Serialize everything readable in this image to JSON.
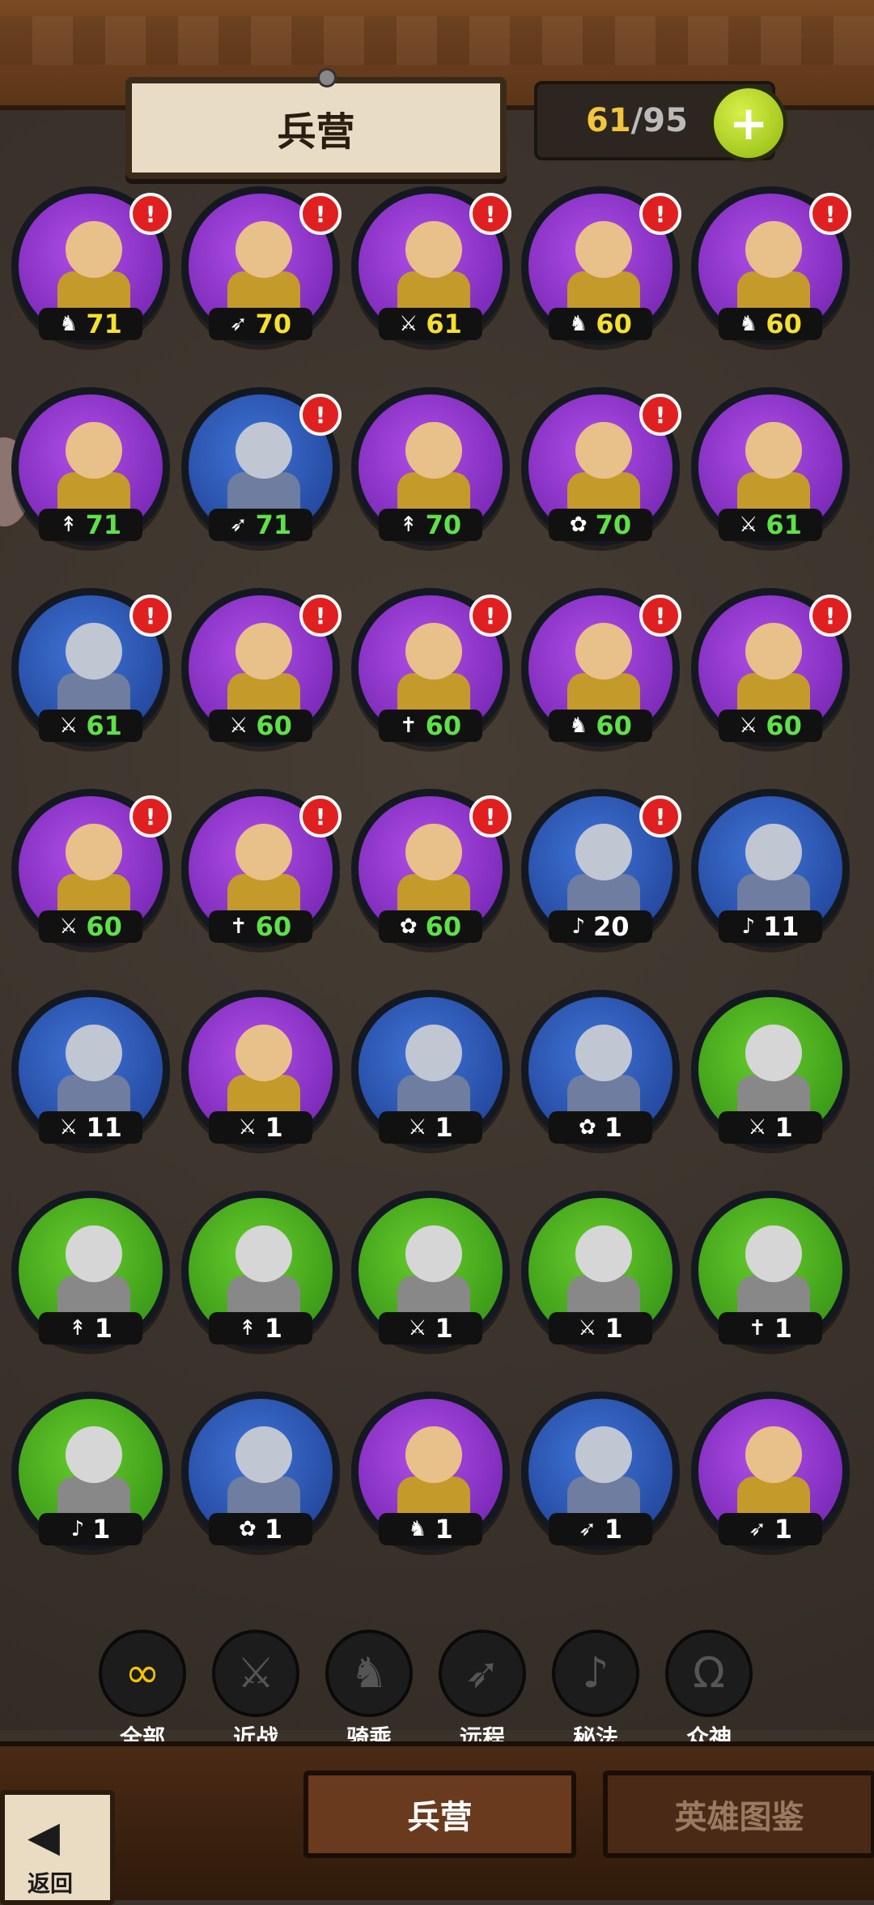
{
  "header": {
    "title": "兵营",
    "count_current": "61",
    "count_sep": "/",
    "count_max": "95",
    "plus_symbol": "+"
  },
  "units": [
    {
      "level": "71",
      "frame": "purple",
      "lv_color": "yellow",
      "icon": "horse",
      "alert": true
    },
    {
      "level": "70",
      "frame": "purple",
      "lv_color": "yellow",
      "icon": "bow",
      "alert": true
    },
    {
      "level": "61",
      "frame": "purple",
      "lv_color": "yellow",
      "icon": "sword",
      "alert": true
    },
    {
      "level": "60",
      "frame": "purple",
      "lv_color": "yellow",
      "icon": "horse",
      "alert": true
    },
    {
      "level": "60",
      "frame": "purple",
      "lv_color": "yellow",
      "icon": "horse",
      "alert": true
    },
    {
      "level": "71",
      "frame": "purple",
      "lv_color": "green",
      "icon": "spear",
      "alert": false
    },
    {
      "level": "71",
      "frame": "blue",
      "lv_color": "green",
      "icon": "bow",
      "alert": true
    },
    {
      "level": "70",
      "frame": "purple",
      "lv_color": "green",
      "icon": "spear",
      "alert": false
    },
    {
      "level": "70",
      "frame": "purple",
      "lv_color": "green",
      "icon": "beast",
      "alert": true
    },
    {
      "level": "61",
      "frame": "purple",
      "lv_color": "green",
      "icon": "sword",
      "alert": false
    },
    {
      "level": "61",
      "frame": "blue",
      "lv_color": "green",
      "icon": "sword",
      "alert": true
    },
    {
      "level": "60",
      "frame": "purple",
      "lv_color": "green",
      "icon": "sword",
      "alert": true
    },
    {
      "level": "60",
      "frame": "purple",
      "lv_color": "green",
      "icon": "cross",
      "alert": true
    },
    {
      "level": "60",
      "frame": "purple",
      "lv_color": "green",
      "icon": "horse",
      "alert": true
    },
    {
      "level": "60",
      "frame": "purple",
      "lv_color": "green",
      "icon": "sword",
      "alert": true
    },
    {
      "level": "60",
      "frame": "purple",
      "lv_color": "green",
      "icon": "sword",
      "alert": true
    },
    {
      "level": "60",
      "frame": "purple",
      "lv_color": "green",
      "icon": "cross",
      "alert": true
    },
    {
      "level": "60",
      "frame": "purple",
      "lv_color": "green",
      "icon": "beast",
      "alert": true
    },
    {
      "level": "20",
      "frame": "blue",
      "lv_color": "white",
      "icon": "magic",
      "alert": true
    },
    {
      "level": "11",
      "frame": "blue",
      "lv_color": "white",
      "icon": "magic",
      "alert": false
    },
    {
      "level": "11",
      "frame": "blue",
      "lv_color": "white",
      "icon": "sword",
      "alert": false
    },
    {
      "level": "1",
      "frame": "purple",
      "lv_color": "white",
      "icon": "sword",
      "alert": false
    },
    {
      "level": "1",
      "frame": "blue",
      "lv_color": "white",
      "icon": "sword",
      "alert": false
    },
    {
      "level": "1",
      "frame": "blue",
      "lv_color": "white",
      "icon": "beast",
      "alert": false
    },
    {
      "level": "1",
      "frame": "green",
      "lv_color": "white",
      "icon": "sword",
      "alert": false
    },
    {
      "level": "1",
      "frame": "green",
      "lv_color": "white",
      "icon": "spear",
      "alert": false
    },
    {
      "level": "1",
      "frame": "green",
      "lv_color": "white",
      "icon": "spear",
      "alert": false
    },
    {
      "level": "1",
      "frame": "green",
      "lv_color": "white",
      "icon": "sword",
      "alert": false
    },
    {
      "level": "1",
      "frame": "green",
      "lv_color": "white",
      "icon": "sword",
      "alert": false
    },
    {
      "level": "1",
      "frame": "green",
      "lv_color": "white",
      "icon": "cross",
      "alert": false
    },
    {
      "level": "1",
      "frame": "green",
      "lv_color": "white",
      "icon": "magic",
      "alert": false
    },
    {
      "level": "1",
      "frame": "blue",
      "lv_color": "white",
      "icon": "beast",
      "alert": false
    },
    {
      "level": "1",
      "frame": "purple",
      "lv_color": "white",
      "icon": "horse",
      "alert": false
    },
    {
      "level": "1",
      "frame": "blue",
      "lv_color": "white",
      "icon": "bow",
      "alert": false
    },
    {
      "level": "1",
      "frame": "purple",
      "lv_color": "white",
      "icon": "bow",
      "alert": false
    }
  ],
  "icons": {
    "horse": "♞",
    "bow": "➶",
    "sword": "⚔",
    "spear": "↟",
    "beast": "✿",
    "cross": "✝",
    "magic": "♪"
  },
  "filters": [
    {
      "label": "全部",
      "glyph": "∞",
      "active": true
    },
    {
      "label": "近战",
      "glyph": "⚔",
      "active": false
    },
    {
      "label": "骑乘",
      "glyph": "♞",
      "active": false
    },
    {
      "label": "远程",
      "glyph": "➶",
      "active": false
    },
    {
      "label": "秘法",
      "glyph": "♪",
      "active": false
    },
    {
      "label": "众神",
      "glyph": "Ω",
      "active": false
    }
  ],
  "footer": {
    "back_label": "返回",
    "back_glyph": "◀",
    "tab_barracks": "兵营",
    "tab_heroes": "英雄图鉴"
  },
  "alert_symbol": "!"
}
